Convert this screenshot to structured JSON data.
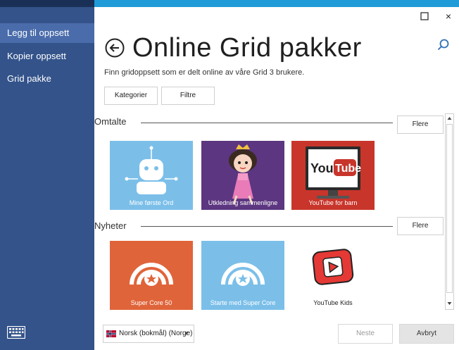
{
  "sidebar": {
    "items": [
      {
        "label": "Legg til oppsett",
        "selected": true
      },
      {
        "label": "Kopier oppsett",
        "selected": false
      },
      {
        "label": "Grid pakke",
        "selected": false
      }
    ],
    "keyboard_icon": "keyboard-icon"
  },
  "window": {
    "maximize_icon": "maximize-icon",
    "close_label": "×"
  },
  "header": {
    "back_icon": "back-arrow-icon",
    "title": "Online Grid pakker",
    "search_icon": "search-icon",
    "subtitle": "Finn gridoppsett som er delt online av våre Grid 3 brukere."
  },
  "filters": {
    "categories_label": "Kategorier",
    "filters_label": "Filtre"
  },
  "sections": [
    {
      "title": "Omtalte",
      "more_label": "Flere",
      "tiles": [
        {
          "label": "Mine første Ord",
          "icon": "robot-icon",
          "color": "#7bbfe9"
        },
        {
          "label": "Utkledning sammenligne",
          "icon": "princess-icon",
          "color": "#5c3680"
        },
        {
          "label": "YouTube for barn",
          "icon": "youtube-tv-icon",
          "color": "#c8352b"
        }
      ]
    },
    {
      "title": "Nyheter",
      "more_label": "Flere",
      "tiles": [
        {
          "label": "Super Core 50",
          "icon": "super-core-icon",
          "color": "#e0643a"
        },
        {
          "label": "Starte med Super Core",
          "icon": "super-core-icon",
          "color": "#7bbfe9"
        },
        {
          "label": "YouTube Kids",
          "icon": "youtube-kids-icon",
          "color": "#ffffff"
        }
      ]
    }
  ],
  "footer": {
    "language": "Norsk (bokmål) (Norge)",
    "next_label": "Neste",
    "cancel_label": "Avbryt"
  }
}
